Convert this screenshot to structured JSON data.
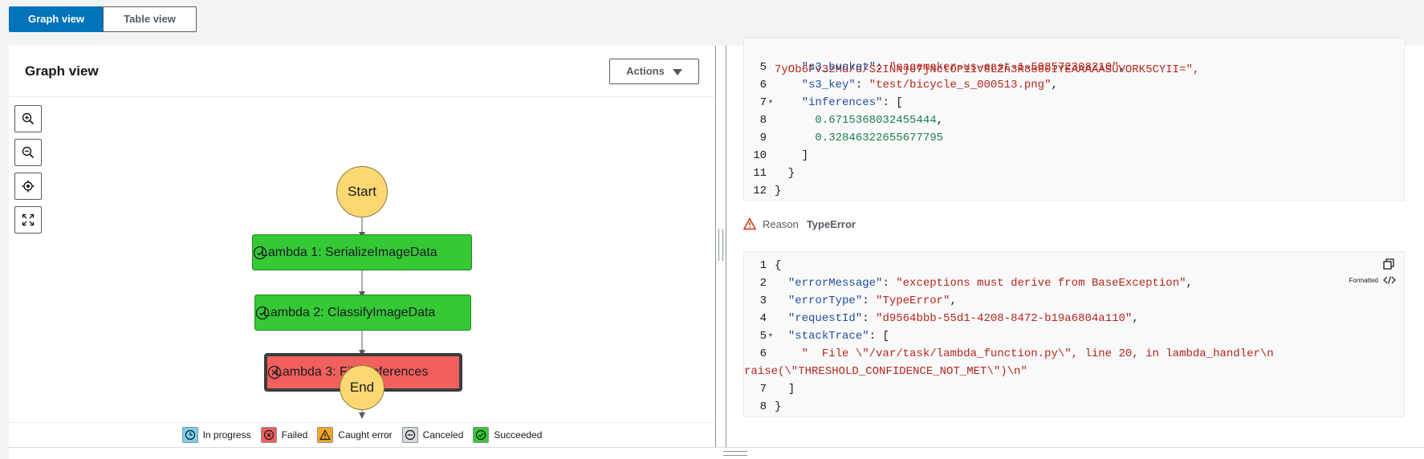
{
  "view_toggle": {
    "graph_label": "Graph view",
    "table_label": "Table view"
  },
  "graph": {
    "title": "Graph view",
    "actions_label": "Actions",
    "nodes": {
      "start": "Start",
      "lambda1": "Lambda 1: SerializeImageData",
      "lambda2": "Lambda 2: ClassifyImageData",
      "lambda3": "Lambda 3: FilterInferences",
      "end": "End"
    },
    "legend": {
      "in_progress": "In progress",
      "failed": "Failed",
      "caught_error": "Caught error",
      "canceled": "Canceled",
      "succeeded": "Succeeded"
    }
  },
  "input_code": {
    "partial_line": "7yOb6Fv3zMd/d/S2INNje7jNctOP11V8LZn3R8880IYEAAAAASUVORK5CYII=\",",
    "lines": [
      {
        "n": "5",
        "key": "\"s3_bucket\"",
        "sep": ": ",
        "val": "\"sagemaker-us-east-1-508572308210\"",
        "tail": ","
      },
      {
        "n": "6",
        "key": "\"s3_key\"",
        "sep": ": ",
        "val": "\"test/bicycle_s_000513.png\"",
        "tail": ","
      },
      {
        "n": "7",
        "key": "\"inferences\"",
        "sep": ": ",
        "val": "[",
        "tail": ""
      },
      {
        "n": "8",
        "num": "0.6715368032455444",
        "tail": ","
      },
      {
        "n": "9",
        "num": "0.32846322655677795",
        "tail": ""
      },
      {
        "n": "10",
        "punct": "]"
      },
      {
        "n": "11",
        "punct": "}"
      },
      {
        "n": "12",
        "punct": "}"
      }
    ]
  },
  "reason": {
    "label": "Reason",
    "value": "TypeError"
  },
  "error_code": {
    "formatted_label": "Formatted",
    "lines": [
      {
        "n": "1",
        "punct": "{"
      },
      {
        "n": "2",
        "key": "\"errorMessage\"",
        "sep": ": ",
        "val": "\"exceptions must derive from BaseException\"",
        "tail": ","
      },
      {
        "n": "3",
        "key": "\"errorType\"",
        "sep": ": ",
        "val": "\"TypeError\"",
        "tail": ","
      },
      {
        "n": "4",
        "key": "\"requestId\"",
        "sep": ": ",
        "val": "\"d9564bbb-55d1-4208-8472-b19a6804a110\"",
        "tail": ","
      },
      {
        "n": "5",
        "key": "\"stackTrace\"",
        "sep": ": ",
        "val": "[",
        "tail": ""
      },
      {
        "n": "6",
        "str": "\"  File \\\"/var/task/lambda_function.py\\\", line 20, in lambda_handler\\n"
      },
      {
        "n": "",
        "str": "raise(\\\"THRESHOLD_CONFIDENCE_NOT_MET\\\")\\n\""
      },
      {
        "n": "7",
        "punct": "]"
      },
      {
        "n": "8",
        "punct": "}"
      }
    ]
  }
}
